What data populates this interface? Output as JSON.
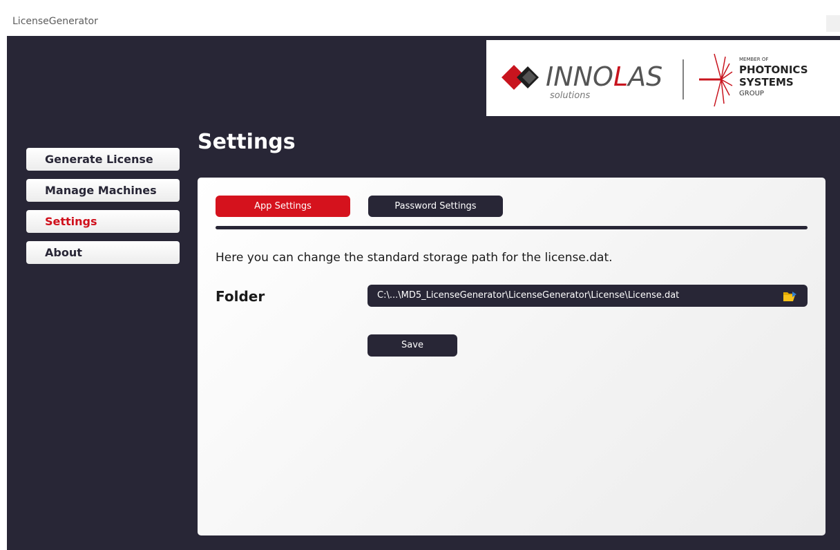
{
  "window": {
    "title": "LicenseGenerator"
  },
  "logo": {
    "brand_name": "INNOLAS",
    "brand_sub": "solutions",
    "group_member": "MEMBER OF",
    "group_line1": "PHOTONICS",
    "group_line2": "SYSTEMS",
    "group_line3": "GROUP"
  },
  "sidebar": {
    "items": [
      {
        "label": "Generate License"
      },
      {
        "label": "Manage Machines"
      },
      {
        "label": "Settings"
      },
      {
        "label": "About"
      }
    ],
    "active": "Settings"
  },
  "page": {
    "title": "Settings"
  },
  "tabs": [
    {
      "label": "App Settings",
      "active": true
    },
    {
      "label": "Password Settings",
      "active": false
    }
  ],
  "app_settings": {
    "description": "Here you can change the standard storage path for the license.dat.",
    "folder_label": "Folder",
    "folder_path": "C:\\...\\MD5_LicenseGenerator\\LicenseGenerator\\License\\License.dat",
    "folder_icon": "folder-open-icon",
    "save_label": "Save"
  },
  "colors": {
    "background": "#282636",
    "accent": "#d5121d",
    "panel": "#f5f5f5"
  }
}
